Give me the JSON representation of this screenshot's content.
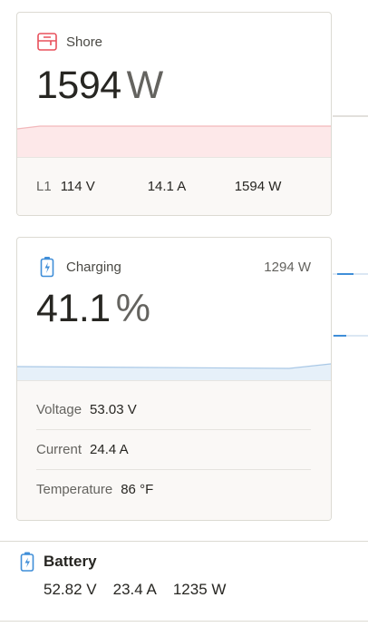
{
  "shore": {
    "title": "Shore",
    "icon": "shore-icon",
    "value": "1594",
    "unit": "W",
    "phase_label": "L1",
    "voltage": "114 V",
    "current": "14.1 A",
    "power": "1594 W",
    "accent": "#e8505b"
  },
  "charger": {
    "title": "Charging",
    "icon": "battery-charging-icon",
    "power": "1294 W",
    "value": "41.1",
    "unit": "%",
    "voltage_label": "Voltage",
    "voltage": "53.03 V",
    "current_label": "Current",
    "current": "24.4 A",
    "temperature_label": "Temperature",
    "temperature": "86 °F",
    "accent": "#3f8ed8"
  },
  "battery": {
    "title": "Battery",
    "icon": "battery-icon",
    "voltage": "52.82 V",
    "current": "23.4 A",
    "power": "1235 W"
  }
}
